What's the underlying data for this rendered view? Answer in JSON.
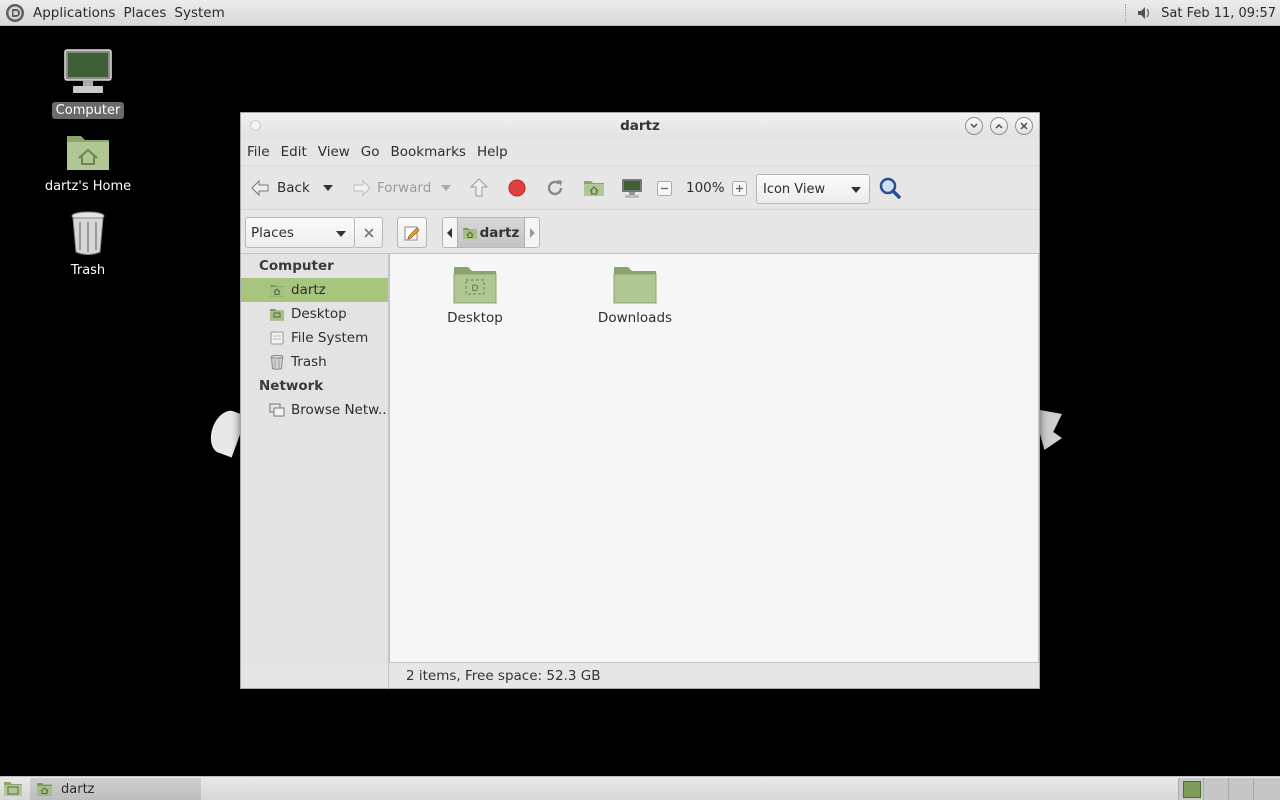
{
  "top_panel": {
    "menus": [
      "Applications",
      "Places",
      "System"
    ],
    "clock": "Sat Feb 11, 09:57",
    "icons": [
      "distro-logo-icon",
      "volume-icon"
    ]
  },
  "desktop": {
    "icons": [
      {
        "label": "Computer",
        "icon": "computer-icon",
        "selected": true
      },
      {
        "label": "dartz's Home",
        "icon": "home-folder-icon",
        "selected": false
      },
      {
        "label": "Trash",
        "icon": "trash-icon",
        "selected": false
      }
    ]
  },
  "window": {
    "title": "dartz",
    "menubar": [
      "File",
      "Edit",
      "View",
      "Go",
      "Bookmarks",
      "Help"
    ],
    "toolbar": {
      "back": "Back",
      "forward": "Forward",
      "zoom": "100%",
      "view_mode": "Icon View"
    },
    "location": {
      "side_pane": "Places",
      "crumb": "dartz"
    },
    "sidebar": {
      "sections": [
        {
          "heading": "Computer",
          "items": [
            {
              "label": "dartz",
              "icon": "home-icon",
              "selected": true
            },
            {
              "label": "Desktop",
              "icon": "desktop-folder-icon",
              "selected": false
            },
            {
              "label": "File System",
              "icon": "drive-icon",
              "selected": false
            },
            {
              "label": "Trash",
              "icon": "trash-icon",
              "selected": false
            }
          ]
        },
        {
          "heading": "Network",
          "items": [
            {
              "label": "Browse Netw...",
              "icon": "network-icon",
              "selected": false
            }
          ]
        }
      ]
    },
    "files": [
      {
        "label": "Desktop",
        "icon": "desktop-folder-icon"
      },
      {
        "label": "Downloads",
        "icon": "folder-icon"
      }
    ],
    "status": "2 items, Free space: 52.3 GB"
  },
  "bottom_panel": {
    "task": "dartz",
    "workspaces": 4,
    "active_workspace": 1
  },
  "colors": {
    "accent": "#a8c57d",
    "folder": "#a9c08a",
    "desktop_bg": "#000000"
  }
}
